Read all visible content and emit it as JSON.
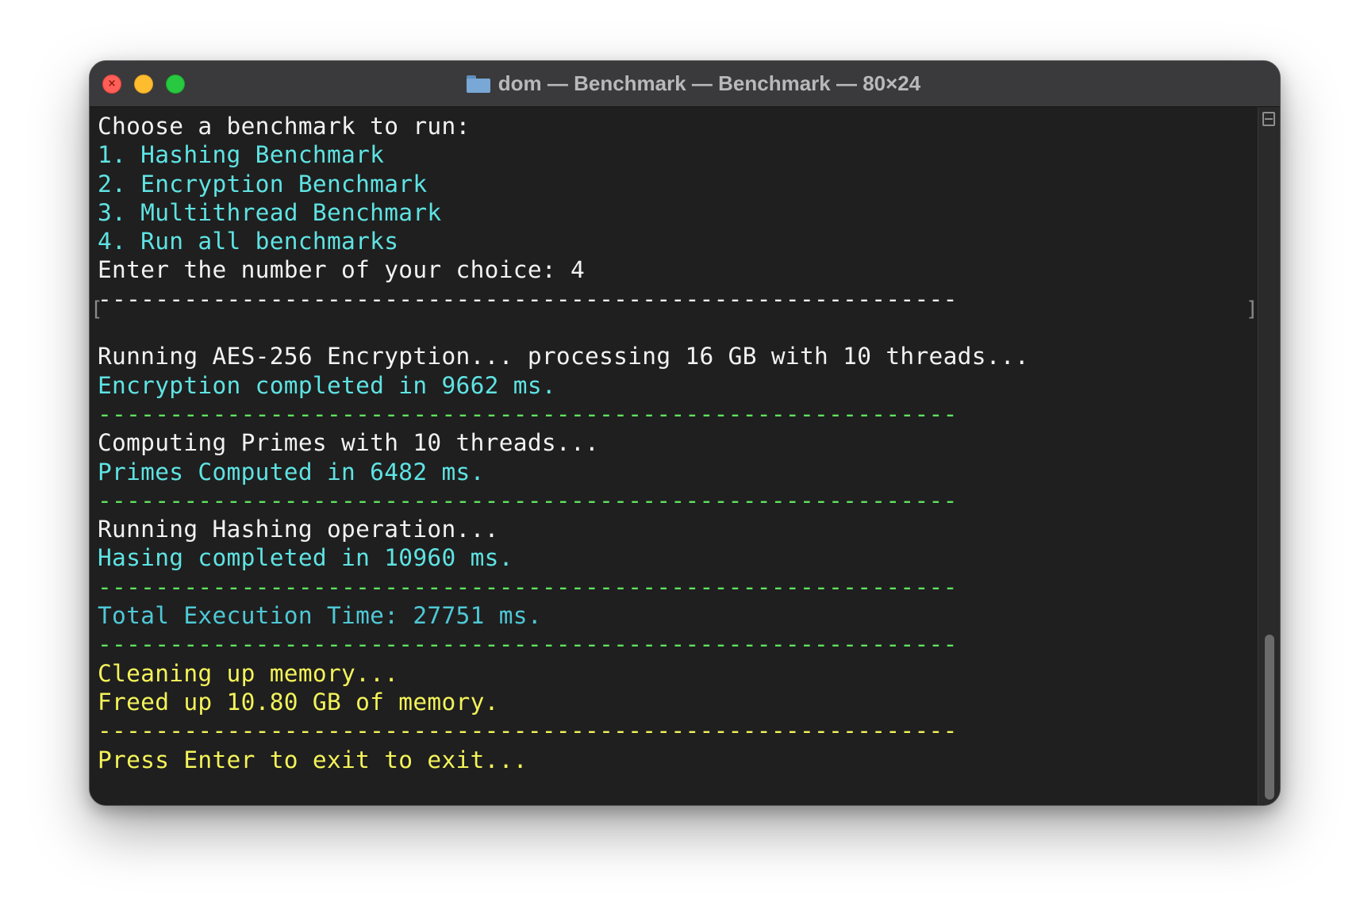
{
  "window": {
    "title": "dom — Benchmark — Benchmark — 80×24",
    "close_glyph": "×"
  },
  "terminal": {
    "lines": [
      {
        "text": "Choose a benchmark to run:",
        "color": "#f2f2f2"
      },
      {
        "text": "1. Hashing Benchmark",
        "color": "#5fe3e3"
      },
      {
        "text": "2. Encryption Benchmark",
        "color": "#5fe3e3"
      },
      {
        "text": "3. Multithread Benchmark",
        "color": "#5fe3e3"
      },
      {
        "text": "4. Run all benchmarks",
        "color": "#5fe3e3"
      },
      {
        "text": "Enter the number of your choice: 4",
        "color": "#f2f2f2"
      },
      {
        "text": "------------------------------------------------------------",
        "color": "#f2f2f2"
      },
      {
        "text": "",
        "color": "#f2f2f2"
      },
      {
        "text": "Running AES-256 Encryption... processing 16 GB with 10 threads...",
        "color": "#f2f2f2"
      },
      {
        "text": "Encryption completed in 9662 ms.",
        "color": "#5fe3e3"
      },
      {
        "text": "------------------------------------------------------------",
        "color": "#5fe35f"
      },
      {
        "text": "Computing Primes with 10 threads...",
        "color": "#f2f2f2"
      },
      {
        "text": "Primes Computed in 6482 ms.",
        "color": "#5fe3e3"
      },
      {
        "text": "------------------------------------------------------------",
        "color": "#5fe35f"
      },
      {
        "text": "Running Hashing operation...",
        "color": "#f2f2f2"
      },
      {
        "text": "Hasing completed in 10960 ms.",
        "color": "#5fe3e3"
      },
      {
        "text": "------------------------------------------------------------",
        "color": "#5fe35f"
      },
      {
        "text": "Total Execution Time: 27751 ms.",
        "color": "#4fc8d6"
      },
      {
        "text": "------------------------------------------------------------",
        "color": "#5fe35f"
      },
      {
        "text": "Cleaning up memory...",
        "color": "#f3f35a"
      },
      {
        "text": "Freed up 10.80 GB of memory.",
        "color": "#f3f35a"
      },
      {
        "text": "------------------------------------------------------------",
        "color": "#f3f35a"
      },
      {
        "text": "Press Enter to exit to exit...",
        "color": "#f3f35a"
      }
    ],
    "bracket_left": "[",
    "bracket_right": "]"
  },
  "colors": {
    "background": "#1f1f1f",
    "titlebar": "#3a3a3c",
    "white": "#f2f2f2",
    "cyan": "#5fe3e3",
    "green": "#5fe35f",
    "yellow": "#f3f35a"
  },
  "icons": {
    "folder": "folder-icon",
    "split": "split-pane-icon"
  }
}
